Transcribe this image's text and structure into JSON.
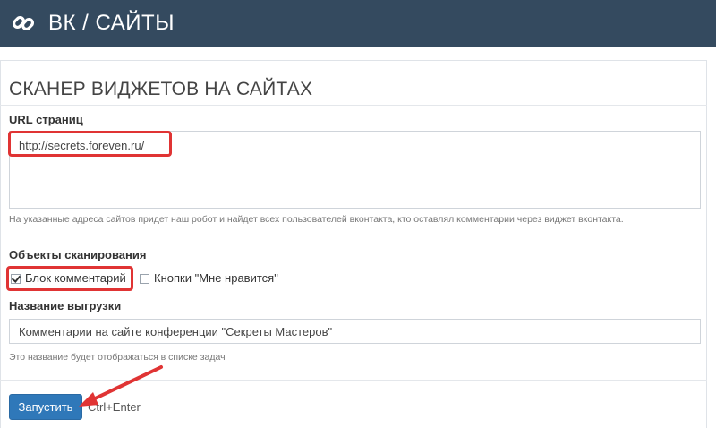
{
  "header": {
    "title": "ВК / САЙТЫ",
    "logo_icon": "chain-link-icon",
    "background": "#344a5f"
  },
  "form": {
    "section_title": "СКАНЕР ВИДЖЕТОВ НА САЙТАХ",
    "url_label": "URL страниц",
    "url_value": "http://secrets.foreven.ru/",
    "url_hint": "На указанные адреса сайтов придет наш робот и найдет всех пользователей вконтакта, кто оставлял комментарии через виджет вконтакта.",
    "objects_label": "Объекты сканирования",
    "options": [
      {
        "label": "Блок комментарий",
        "checked": true
      },
      {
        "label": "Кнопки \"Мне нравится\"",
        "checked": false
      }
    ],
    "export_label": "Название выгрузки",
    "export_value": "Комментарии на сайте конференции \"Секреты Мастеров\"",
    "export_hint": "Это название будет отображаться в списке задач",
    "submit_label": "Запустить",
    "shortcut_label": "Ctrl+Enter"
  },
  "colors": {
    "highlight": "#e03434",
    "button": "#2f78b9"
  }
}
